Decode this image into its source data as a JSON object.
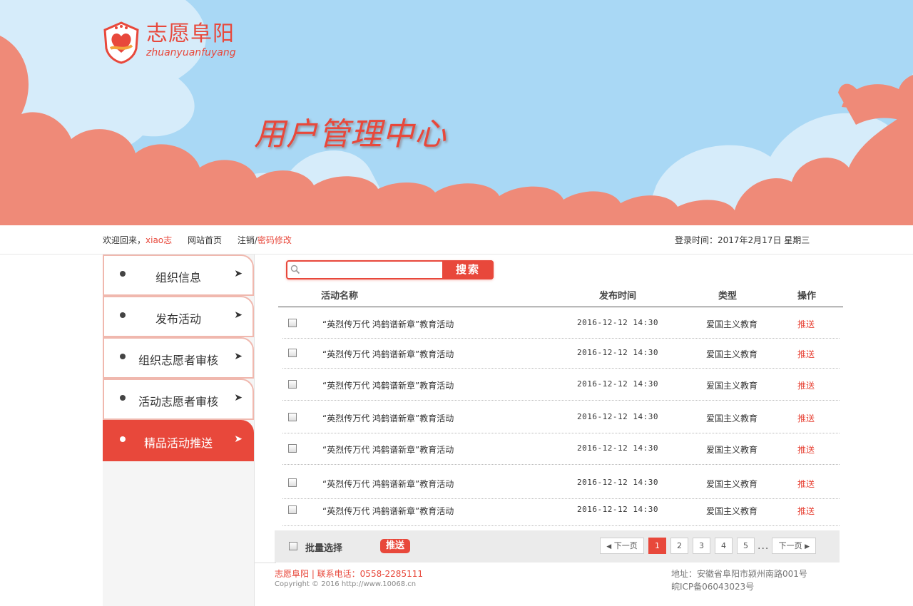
{
  "brand": {
    "name_cn": "志愿阜阳",
    "name_en": "zhuanyuanfuyang",
    "banner_title": "用户管理中心"
  },
  "userbar": {
    "welcome": "欢迎回来，",
    "username": "xiao志",
    "home": "网站首页",
    "logout": "注销",
    "sep": " / ",
    "change_password": "密码修改",
    "login_time": "登录时间：2017年2月17日  星期三"
  },
  "sidebar": {
    "items": [
      {
        "label": "组织信息",
        "active": false
      },
      {
        "label": "发布活动",
        "active": false
      },
      {
        "label": "组织志愿者审核",
        "active": false
      },
      {
        "label": "活动志愿者审核",
        "active": false
      },
      {
        "label": "精品活动推送",
        "active": true
      }
    ]
  },
  "search": {
    "placeholder": "",
    "button_label": "搜索"
  },
  "table": {
    "headers": [
      "活动名称",
      "发布时间",
      "类型",
      "操作"
    ],
    "rows": [
      {
        "name": "“英烈传万代  鸿鹤谱新章”教育活动",
        "time": "2016-12-12  14:30",
        "type": "爱国主义教育",
        "action": "推送"
      },
      {
        "name": "“英烈传万代  鸿鹤谱新章”教育活动",
        "time": "2016-12-12  14:30",
        "type": "爱国主义教育",
        "action": "推送"
      },
      {
        "name": "“英烈传万代  鸿鹤谱新章”教育活动",
        "time": "2016-12-12  14:30",
        "type": "爱国主义教育",
        "action": "推送"
      },
      {
        "name": "“英烈传万代  鸿鹤谱新章”教育活动",
        "time": "2016-12-12  14:30",
        "type": "爱国主义教育",
        "action": "推送"
      },
      {
        "name": "“英烈传万代  鸿鹤谱新章”教育活动",
        "time": "2016-12-12  14:30",
        "type": "爱国主义教育",
        "action": "推送"
      },
      {
        "name": "“英烈传万代  鸿鹤谱新章”教育活动",
        "time": "2016-12-12  14:30",
        "type": "爱国主义教育",
        "action": "推送"
      },
      {
        "name": "“英烈传万代  鸿鹤谱新章”教育活动",
        "time": "2016-12-12  14:30",
        "type": "爱国主义教育",
        "action": "推送"
      }
    ]
  },
  "bulk": {
    "select_all": "批量选择",
    "push": "推送"
  },
  "pager": {
    "prev": "下一页",
    "pages": [
      "1",
      "2",
      "3",
      "4",
      "5"
    ],
    "current": "1",
    "ellipsis": "...",
    "next": "下一页"
  },
  "footer": {
    "contact": "志愿阜阳 | 联系电话：0558-2285111",
    "copyright": "Copyright © 2016 http://www.10068.cn",
    "address": "地址：安徽省阜阳市颍州南路001号",
    "icp": "皖ICP备06043023号"
  },
  "colors": {
    "accent": "#e8483b",
    "sky": "#a9d8f5",
    "cloud": "#ef8a78",
    "cloud_light": "#d6ecfa"
  }
}
